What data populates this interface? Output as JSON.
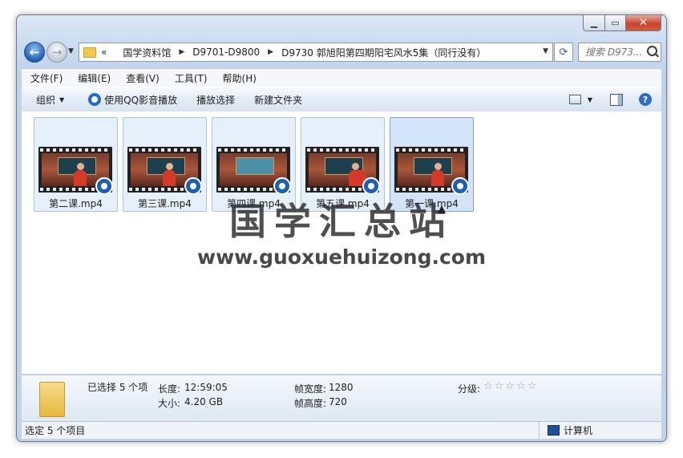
{
  "window": {
    "caption_buttons": {
      "minimize_icon": "minimize-icon",
      "maximize_icon": "maximize-icon",
      "close_icon": "close-icon"
    }
  },
  "nav": {
    "back_icon": "back-arrow-icon",
    "forward_icon": "forward-arrow-icon",
    "prefix": "«",
    "breadcrumbs": [
      "国学资料馆",
      "D9701-D9800",
      "D9730 郭旭阳第四期阳宅风水5集（同行没有）"
    ],
    "search_placeholder": "搜索 D973..."
  },
  "menu": [
    "文件(F)",
    "编辑(E)",
    "查看(V)",
    "工具(T)",
    "帮助(H)"
  ],
  "toolbar": {
    "organize": "组织",
    "qq_play": "使用QQ影音播放",
    "play_selection": "播放选择",
    "new_folder": "新建文件夹"
  },
  "files": [
    {
      "name": "第二课.mp4"
    },
    {
      "name": "第三课.mp4"
    },
    {
      "name": "第四课.mp4"
    },
    {
      "name": "第五课.mp4"
    },
    {
      "name": "第一课.mp4"
    }
  ],
  "watermark": {
    "chinese": "国学汇总站",
    "url": "www.guoxuehuizong.com"
  },
  "details": {
    "selected": "已选择 5 个项",
    "duration_label": "长度:",
    "duration": "12:59:05",
    "size_label": "大小:",
    "size": "4.20 GB",
    "frame_width_label": "帧宽度:",
    "frame_width": "1280",
    "frame_height_label": "帧高度:",
    "frame_height": "720",
    "rating_label": "分级:",
    "rating": 0,
    "rating_max": 5
  },
  "status": {
    "left": "选定 5 个项目",
    "right": "计算机"
  }
}
